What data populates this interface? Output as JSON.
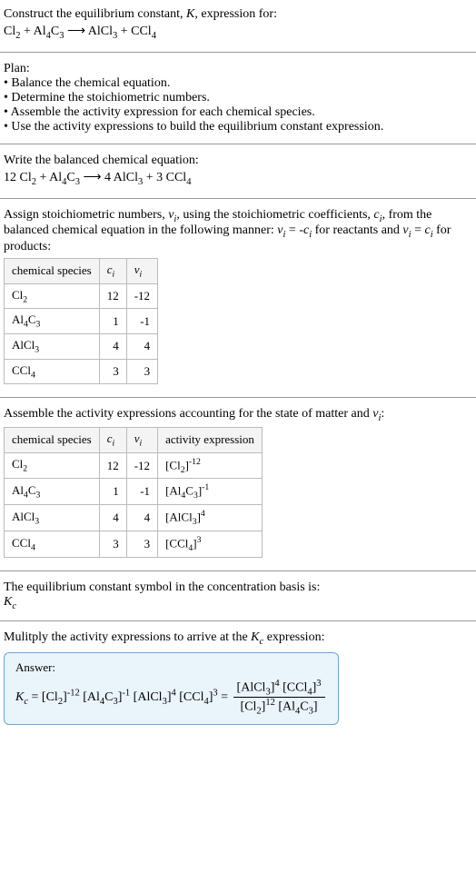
{
  "title_lines": [
    "Construct the equilibrium constant, K, expression for:",
    "Cl₂ + Al₄C₃ ⟶ AlCl₃ + CCl₄"
  ],
  "plan": {
    "heading": "Plan:",
    "items": [
      "• Balance the chemical equation.",
      "• Determine the stoichiometric numbers.",
      "• Assemble the activity expression for each chemical species.",
      "• Use the activity expressions to build the equilibrium constant expression."
    ]
  },
  "balanced": {
    "heading": "Write the balanced chemical equation:",
    "equation": "12 Cl₂ + Al₄C₃ ⟶ 4 AlCl₃ + 3 CCl₄"
  },
  "assign": {
    "text": "Assign stoichiometric numbers, νᵢ, using the stoichiometric coefficients, cᵢ, from the balanced chemical equation in the following manner: νᵢ = -cᵢ for reactants and νᵢ = cᵢ for products:",
    "headers": [
      "chemical species",
      "cᵢ",
      "νᵢ"
    ],
    "rows": [
      {
        "species": "Cl₂",
        "c": "12",
        "v": "-12"
      },
      {
        "species": "Al₄C₃",
        "c": "1",
        "v": "-1"
      },
      {
        "species": "AlCl₃",
        "c": "4",
        "v": "4"
      },
      {
        "species": "CCl₄",
        "c": "3",
        "v": "3"
      }
    ]
  },
  "activity": {
    "text": "Assemble the activity expressions accounting for the state of matter and νᵢ:",
    "headers": [
      "chemical species",
      "cᵢ",
      "νᵢ",
      "activity expression"
    ],
    "rows": [
      {
        "species": "Cl₂",
        "c": "12",
        "v": "-12",
        "expr_base": "[Cl₂]",
        "expr_pow": "-12"
      },
      {
        "species": "Al₄C₃",
        "c": "1",
        "v": "-1",
        "expr_base": "[Al₄C₃]",
        "expr_pow": "-1"
      },
      {
        "species": "AlCl₃",
        "c": "4",
        "v": "4",
        "expr_base": "[AlCl₃]",
        "expr_pow": "4"
      },
      {
        "species": "CCl₄",
        "c": "3",
        "v": "3",
        "expr_base": "[CCl₄]",
        "expr_pow": "3"
      }
    ]
  },
  "symbol": {
    "text": "The equilibrium constant symbol in the concentration basis is:",
    "value": "K_c"
  },
  "multiply_text": "Mulitply the activity expressions to arrive at the K_c expression:",
  "answer": {
    "label": "Answer:",
    "lhs": "K_c",
    "product_parts": [
      {
        "base": "[Cl₂]",
        "pow": "-12"
      },
      {
        "base": "[Al₄C₃]",
        "pow": "-1"
      },
      {
        "base": "[AlCl₃]",
        "pow": "4"
      },
      {
        "base": "[CCl₄]",
        "pow": "3"
      }
    ],
    "fraction": {
      "num_parts": [
        {
          "base": "[AlCl₃]",
          "pow": "4"
        },
        {
          "base": "[CCl₄]",
          "pow": "3"
        }
      ],
      "den_parts": [
        {
          "base": "[Cl₂]",
          "pow": "12"
        },
        {
          "base": "[Al₄C₃]",
          "pow": ""
        }
      ]
    }
  },
  "chart_data": {
    "type": "table",
    "tables": [
      {
        "title": "Stoichiometric numbers",
        "headers": [
          "chemical species",
          "c_i",
          "ν_i"
        ],
        "rows": [
          [
            "Cl2",
            12,
            -12
          ],
          [
            "Al4C3",
            1,
            -1
          ],
          [
            "AlCl3",
            4,
            4
          ],
          [
            "CCl4",
            3,
            3
          ]
        ]
      },
      {
        "title": "Activity expressions",
        "headers": [
          "chemical species",
          "c_i",
          "ν_i",
          "activity expression"
        ],
        "rows": [
          [
            "Cl2",
            12,
            -12,
            "[Cl2]^-12"
          ],
          [
            "Al4C3",
            1,
            -1,
            "[Al4C3]^-1"
          ],
          [
            "AlCl3",
            4,
            4,
            "[AlCl3]^4"
          ],
          [
            "CCl4",
            3,
            3,
            "[CCl4]^3"
          ]
        ]
      }
    ],
    "equilibrium_constant": "K_c = [AlCl3]^4 [CCl4]^3 / ([Cl2]^12 [Al4C3])"
  }
}
